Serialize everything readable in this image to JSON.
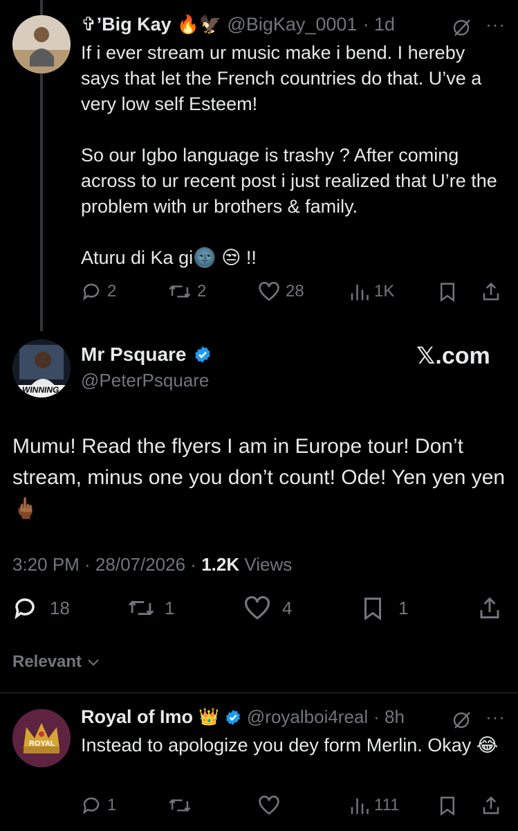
{
  "reply1": {
    "display_name": "✞’Big Kay",
    "name_emojis": "🔥🦅",
    "handle": "@BigKay_0001",
    "time": "· 1d",
    "text": "If i ever stream ur music make i bend. I hereby says that let the French countries do that. U’ve a very low self Esteem!\n\nSo our Igbo language is trashy ? After coming across to ur recent post i just realized that U’re the problem with ur brothers & family.\n\nAturu di Ka gi🌚 😒 !!",
    "stats": {
      "replies": "2",
      "reposts": "2",
      "likes": "28",
      "views": "1K"
    }
  },
  "main": {
    "display_name": "Mr Psquare",
    "handle": "@PeterPsquare",
    "brand": "𝕏.com",
    "avatar_caption": "WINNING",
    "text": "Mumu! Read the flyers I am in Europe tour! Don’t stream, minus one you don’t count! Ode! Yen yen yen🖕🏾",
    "timestamp": "3:20 PM · 28/07/2026 ·",
    "views_count": "1.2K",
    "views_label": "Views",
    "stats": {
      "replies": "18",
      "reposts": "1",
      "likes": "4",
      "bookmarks": "1"
    }
  },
  "sort": {
    "label": "Relevant"
  },
  "reply2": {
    "display_name": "Royal of Imo",
    "name_emojis": "👑",
    "handle": "@royalboi4real",
    "time": "· 8h",
    "avatar_caption": "ROYAL",
    "text": "Instead to apologize you dey form Merlin. Okay 😂",
    "stats": {
      "replies": "1",
      "reposts": "",
      "likes": "",
      "views": "111"
    }
  },
  "colors": {
    "background": "#000000",
    "text": "#e7e9ea",
    "muted": "#71767b",
    "verified": "#1d9bf0"
  }
}
